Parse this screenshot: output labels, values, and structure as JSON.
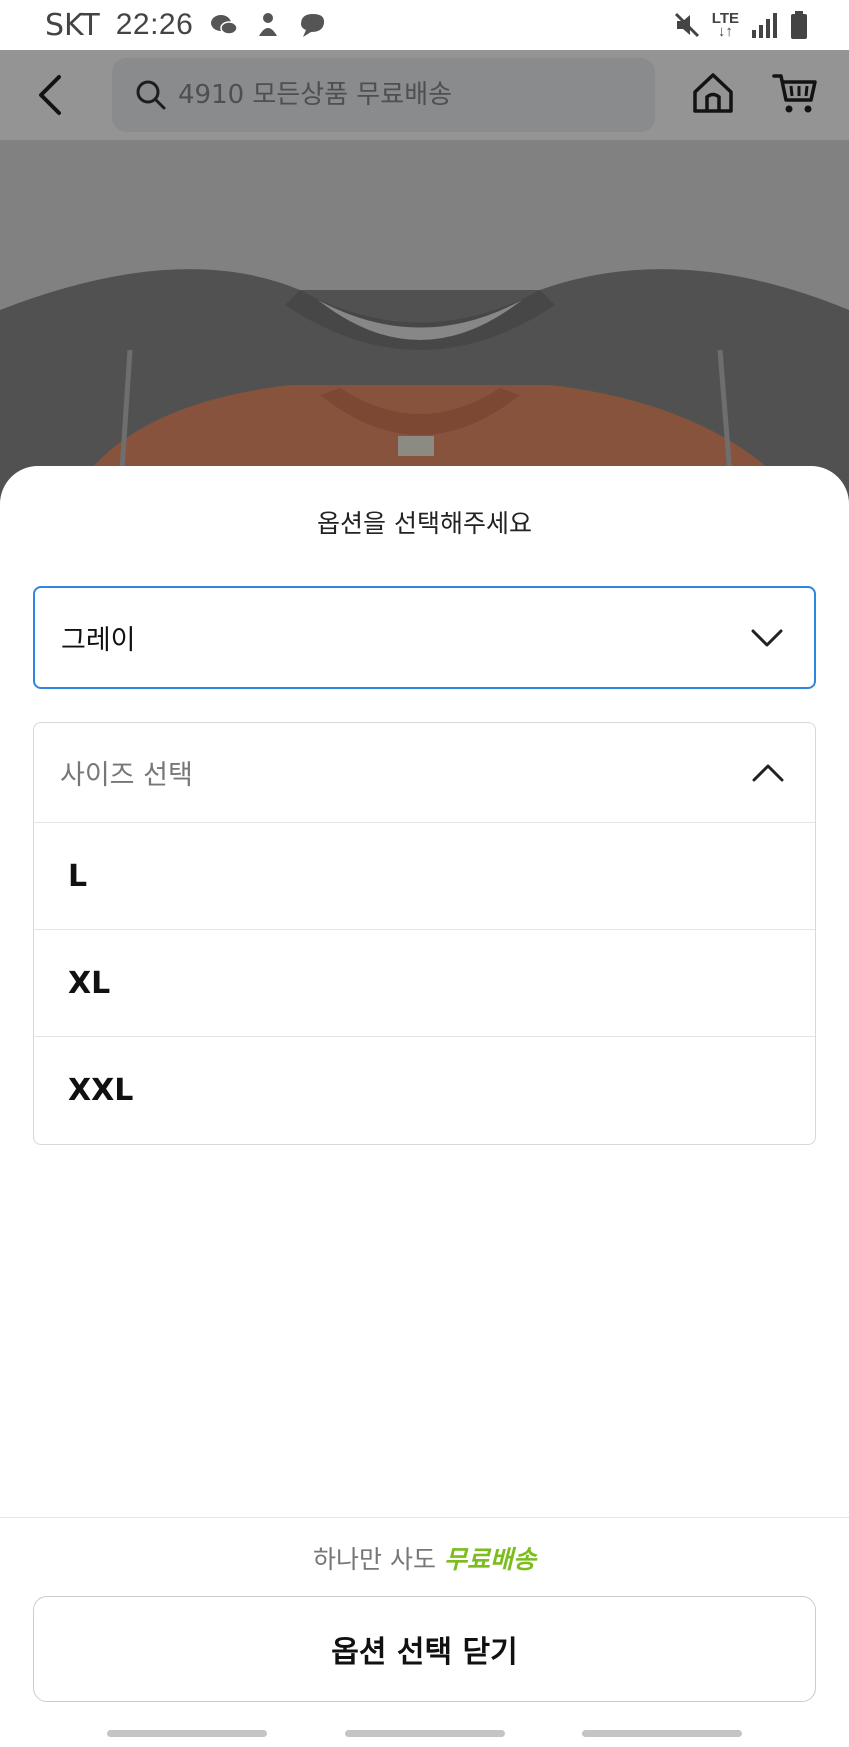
{
  "status_bar": {
    "carrier": "SKT",
    "time": "22:26",
    "network": "LTE",
    "icons": [
      "chat-bubble-icon",
      "figure-icon",
      "chat-icon",
      "mute-icon",
      "signal-icon",
      "battery-icon"
    ]
  },
  "header": {
    "search_placeholder": "4910 모든상품 무료배송",
    "icons": [
      "back-arrow-icon",
      "search-icon",
      "home-icon",
      "cart-icon"
    ]
  },
  "sheet": {
    "title": "옵션을 선택해주세요",
    "color_select": {
      "value": "그레이"
    },
    "size_select": {
      "placeholder": "사이즈 선택",
      "options": [
        "L",
        "XL",
        "XXL"
      ]
    },
    "shipping_prefix": "하나만 사도",
    "shipping_highlight": "무료배송",
    "close_label": "옵션 선택 닫기"
  },
  "colors": {
    "accent_border": "#2e86de",
    "free_shipping": "#7cbd1e",
    "product_gray": "#8c8c8c",
    "product_orange": "#e9906a"
  }
}
